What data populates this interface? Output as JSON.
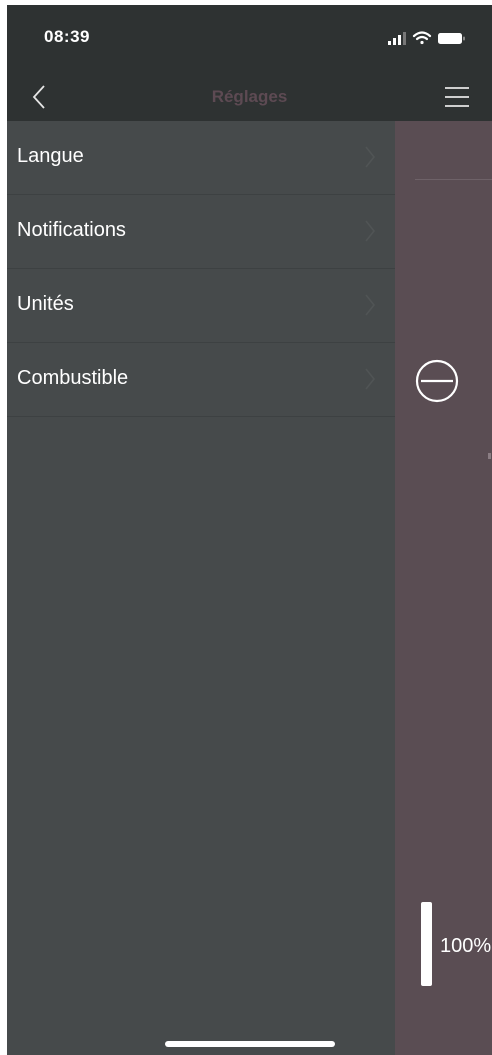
{
  "status_bar": {
    "time": "08:39",
    "icons": [
      "cellular-signal-icon",
      "wifi-icon",
      "battery-icon"
    ]
  },
  "nav_bar": {
    "title": "Réglages",
    "back_icon": "chevron-left-icon",
    "menu_icon": "hamburger-menu-icon"
  },
  "drawer": {
    "items": [
      {
        "label": "Langue"
      },
      {
        "label": "Notifications"
      },
      {
        "label": "Unités"
      },
      {
        "label": "Combustible"
      }
    ]
  },
  "background": {
    "level_text": "100%",
    "level_fraction": 1.0
  },
  "colors": {
    "bar_bg": "#2e3232",
    "drawer_bg": "#464a4b",
    "content_bg": "#5a4d53",
    "title_color": "#5d4a53",
    "text": "#ffffff"
  }
}
